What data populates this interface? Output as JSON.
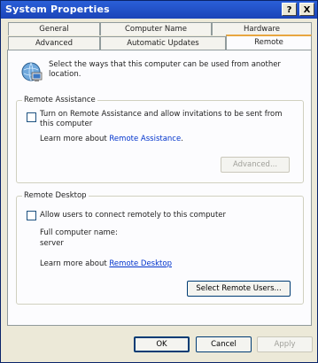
{
  "window": {
    "title": "System Properties",
    "help_label": "?",
    "close_label": "X"
  },
  "tabs": {
    "row1": [
      "General",
      "Computer Name",
      "Hardware"
    ],
    "row2": [
      "Advanced",
      "Automatic Updates",
      "Remote"
    ],
    "active": "Remote"
  },
  "intro": {
    "text": "Select the ways that this computer can be used from another location.",
    "icon": "computer-network-icon"
  },
  "remote_assistance": {
    "group_label": "Remote Assistance",
    "checkbox_label": "Turn on Remote Assistance and allow invitations to be sent from this computer",
    "checked": false,
    "learn_prefix": "Learn more about ",
    "learn_link": "Remote Assistance",
    "learn_suffix": ".",
    "advanced_label": "Advanced..."
  },
  "remote_desktop": {
    "group_label": "Remote Desktop",
    "checkbox_label": "Allow users to connect remotely to this computer",
    "checked": false,
    "full_name_label": "Full computer name:",
    "full_name_value": "server",
    "learn_prefix": "Learn more about ",
    "learn_link": "Remote Desktop",
    "select_users_label": "Select Remote Users..."
  },
  "footer": {
    "ok_label": "OK",
    "cancel_label": "Cancel",
    "apply_label": "Apply"
  }
}
